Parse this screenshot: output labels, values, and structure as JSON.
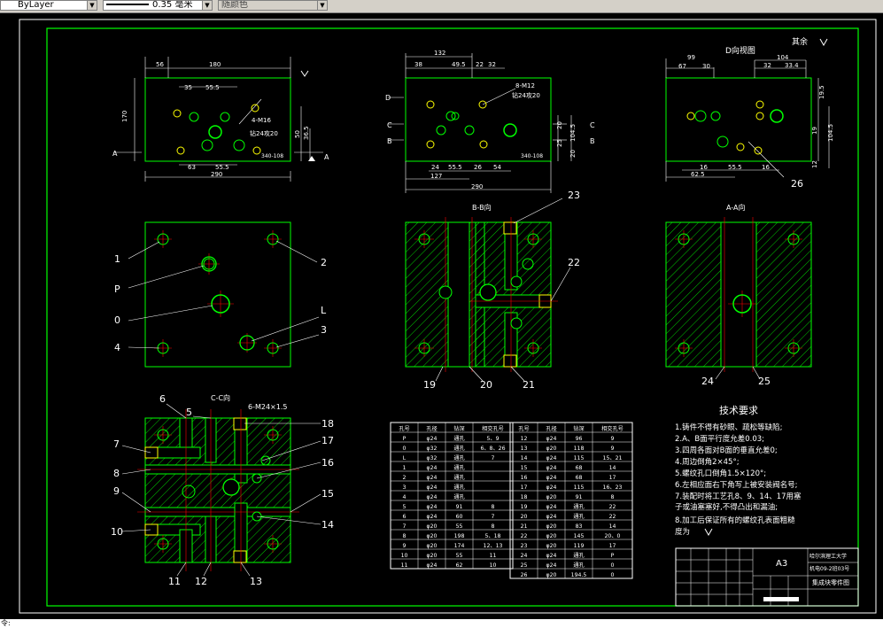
{
  "toolbar": {
    "layer": "ByLayer",
    "lineweight": "0.35 毫米",
    "color": "随颜色"
  },
  "command_line": "令:",
  "drawing": {
    "view_d_title": "D向视图",
    "roughness_other": "其余",
    "bb_title": "B-B向",
    "aa_title": "A-A向",
    "cc_title": "C-C向",
    "tech_title": "技术要求",
    "tech_items": [
      "1.铸件不得有砂眼、疏松等缺陷;",
      "2.A、B面平行度允差0.03;",
      "3.四周各面对B面的垂直允差0;",
      "4.周边倒角2×45°;",
      "5.螺纹孔口倒角1.5×120°;",
      "6.左相应面右下角写上被安装阀名号;",
      "7.装配时将工艺孔8、9、14、17用塞",
      "  子或油塞塞好,不得凸出和漏油;",
      "8.加工后保证所有的螺纹孔表面粗糙",
      "  度为"
    ],
    "dims_top_left": [
      "56",
      "180",
      "35",
      "55.5",
      "63",
      "55.5",
      "290",
      "170",
      "50",
      "36.5",
      "8.5",
      "20"
    ],
    "notes_top_left": [
      "4-M16",
      "钻24攻20",
      "340-108"
    ],
    "dims_top_mid": [
      "132",
      "38",
      "49.5",
      "22",
      "32",
      "24",
      "55.5",
      "26",
      "54",
      "127",
      "290",
      "20",
      "25",
      "104.5",
      "20"
    ],
    "notes_top_mid": [
      "8-M12",
      "钻24攻20",
      "340-108"
    ],
    "dims_top_right": [
      "99",
      "67",
      "30",
      "104",
      "32",
      "33.4",
      "19.5",
      "19",
      "104.5",
      "12",
      "16",
      "55.5",
      "16",
      "62.5"
    ],
    "section_labels": {
      "A": "A",
      "B": "B",
      "C": "C",
      "D": "D"
    },
    "callouts_mid": [
      "1",
      "2",
      "P",
      "0",
      "L",
      "3",
      "4"
    ],
    "callouts_bb": [
      "19",
      "20",
      "21",
      "22",
      "23"
    ],
    "callouts_aa": [
      "24",
      "25"
    ],
    "callout_26": "26",
    "callouts_cc": [
      "6",
      "5",
      "7",
      "8",
      "9",
      "10",
      "11",
      "12",
      "13",
      "14",
      "15",
      "16",
      "17",
      "18"
    ],
    "cc_note": "6-M24×1.5",
    "table_headers": [
      "孔号",
      "孔径",
      "钻深",
      "相交孔号"
    ],
    "table_left": [
      [
        "P",
        "φ24",
        "通孔",
        "5、9"
      ],
      [
        "0",
        "φ32",
        "通孔",
        "6、8、26"
      ],
      [
        "L",
        "φ32",
        "通孔",
        "7"
      ],
      [
        "1",
        "φ24",
        "通孔",
        ""
      ],
      [
        "2",
        "φ24",
        "通孔",
        ""
      ],
      [
        "3",
        "φ24",
        "通孔",
        ""
      ],
      [
        "4",
        "φ24",
        "通孔",
        ""
      ],
      [
        "5",
        "φ24",
        "91",
        "8"
      ],
      [
        "6",
        "φ24",
        "60",
        "7"
      ],
      [
        "7",
        "φ20",
        "55",
        "8"
      ],
      [
        "8",
        "φ20",
        "198",
        "5、18"
      ],
      [
        "9",
        "φ20",
        "174",
        "12、13"
      ],
      [
        "10",
        "φ20",
        "55",
        "11"
      ],
      [
        "11",
        "φ24",
        "62",
        "10"
      ]
    ],
    "table_right": [
      [
        "12",
        "φ24",
        "96",
        "9"
      ],
      [
        "13",
        "φ20",
        "118",
        "9"
      ],
      [
        "14",
        "φ24",
        "115",
        "15、21"
      ],
      [
        "15",
        "φ24",
        "68",
        "14"
      ],
      [
        "16",
        "φ24",
        "68",
        "17"
      ],
      [
        "17",
        "φ24",
        "115",
        "16、23"
      ],
      [
        "18",
        "φ20",
        "91",
        "8"
      ],
      [
        "19",
        "φ24",
        "通孔",
        "22"
      ],
      [
        "20",
        "φ24",
        "通孔",
        "22"
      ],
      [
        "21",
        "φ20",
        "83",
        "14"
      ],
      [
        "22",
        "φ20",
        "145",
        "20、0"
      ],
      [
        "23",
        "φ20",
        "119",
        "17"
      ],
      [
        "24",
        "φ24",
        "通孔",
        "P"
      ],
      [
        "25",
        "φ24",
        "通孔",
        "0"
      ],
      [
        "26",
        "φ20",
        "194.5",
        "0"
      ]
    ],
    "title_block": {
      "size": "A3",
      "school": "哈尔滨理工大学",
      "class_no": "机电09-2班03号",
      "name": "集成块零件图"
    }
  },
  "colors": {
    "green": "#00ff00",
    "white": "#ffffff",
    "red": "#ff0000",
    "yellow": "#ffff00"
  }
}
